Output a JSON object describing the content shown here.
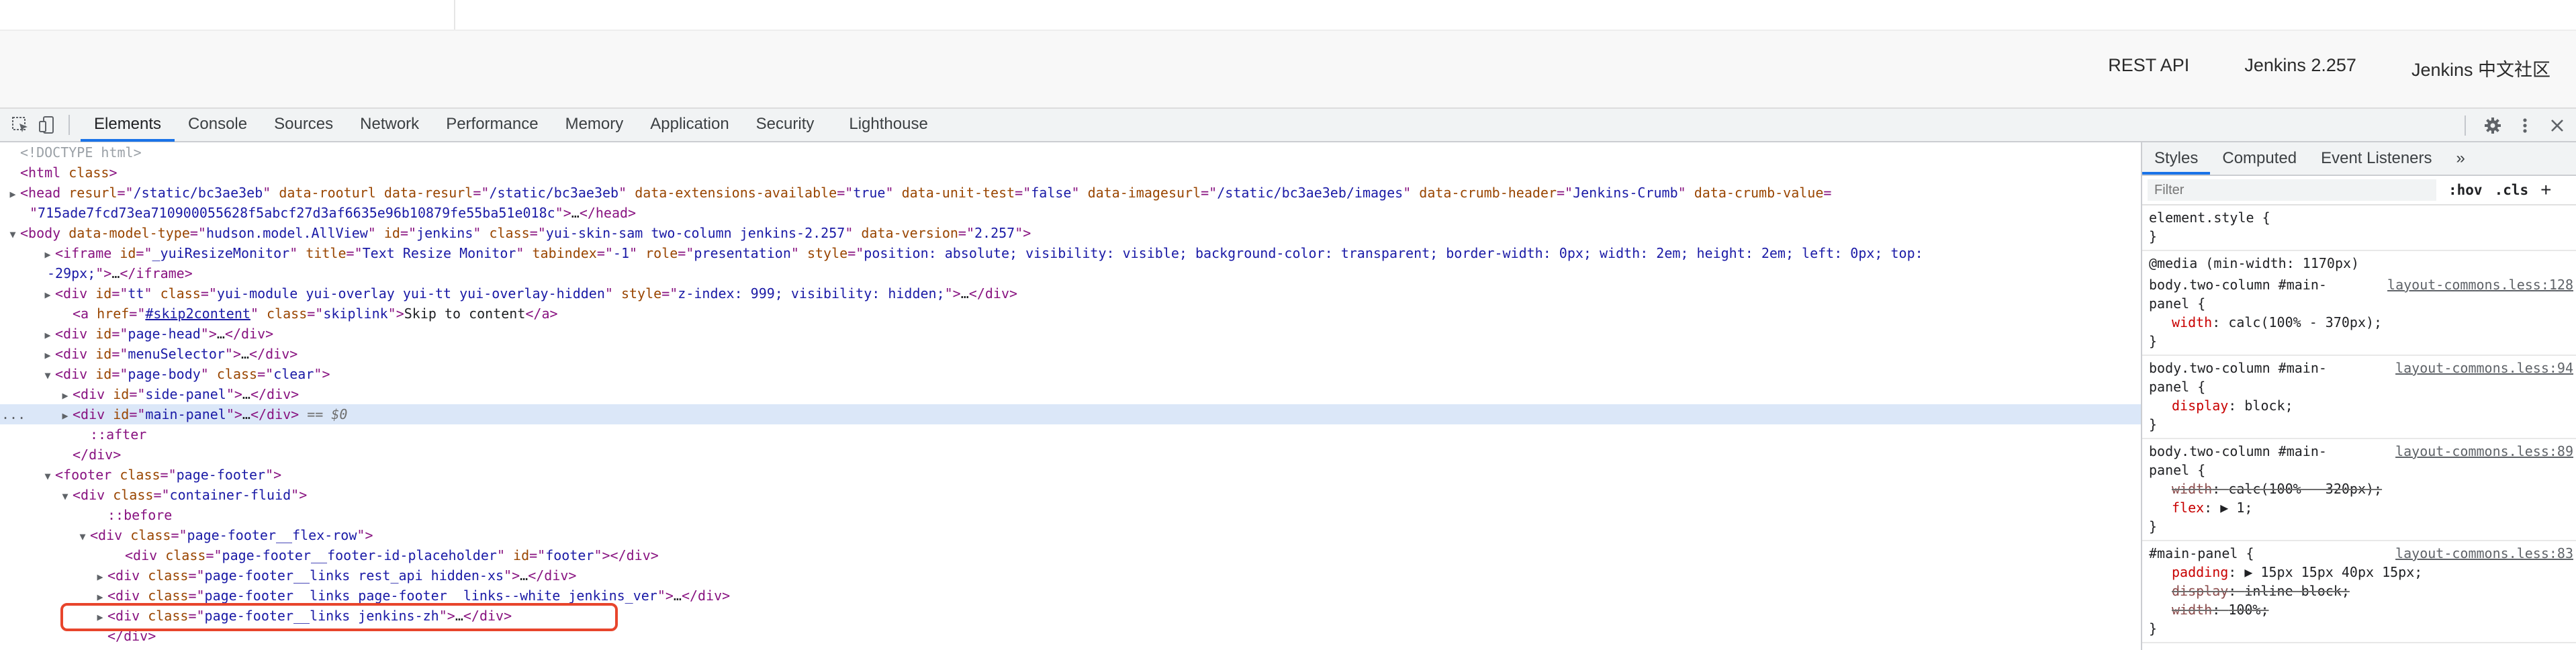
{
  "page": {
    "footer_links": [
      "REST API",
      "Jenkins 2.257",
      "Jenkins 中文社区"
    ]
  },
  "devtools": {
    "tabs": [
      "Elements",
      "Console",
      "Sources",
      "Network",
      "Performance",
      "Memory",
      "Application",
      "Security",
      "Lighthouse"
    ],
    "active_tab": "Elements",
    "icons": [
      "inspect-element-icon",
      "device-toolbar-icon",
      "settings-gear-icon",
      "more-vertical-icon",
      "close-icon"
    ]
  },
  "elements": {
    "lines": [
      {
        "seg": [
          {
            "c": "t-comment",
            "t": "<!DOCTYPE html>"
          }
        ]
      },
      {
        "seg": [
          {
            "c": "t-tag",
            "t": "<html "
          },
          {
            "c": "t-attr",
            "t": "class"
          },
          {
            "c": "t-tag",
            "t": ">"
          }
        ]
      },
      {
        "seg": [
          {
            "c": "t-tag",
            "t": "<head "
          },
          {
            "c": "t-attr",
            "t": "resurl"
          },
          {
            "c": "t-tag",
            "t": "=\""
          },
          {
            "c": "t-val",
            "t": "/static/bc3ae3eb"
          },
          {
            "c": "t-tag",
            "t": "\" "
          },
          {
            "c": "t-attr",
            "t": "data-rooturl"
          },
          {
            "c": "t-tag",
            "t": " "
          },
          {
            "c": "t-attr",
            "t": "data-resurl"
          },
          {
            "c": "t-tag",
            "t": "=\""
          },
          {
            "c": "t-val",
            "t": "/static/bc3ae3eb"
          },
          {
            "c": "t-tag",
            "t": "\" "
          },
          {
            "c": "t-attr",
            "t": "data-extensions-available"
          },
          {
            "c": "t-tag",
            "t": "=\""
          },
          {
            "c": "t-val",
            "t": "true"
          },
          {
            "c": "t-tag",
            "t": "\" "
          },
          {
            "c": "t-attr",
            "t": "data-unit-test"
          },
          {
            "c": "t-tag",
            "t": "=\""
          },
          {
            "c": "t-val",
            "t": "false"
          },
          {
            "c": "t-tag",
            "t": "\" "
          },
          {
            "c": "t-attr",
            "t": "data-imagesurl"
          },
          {
            "c": "t-tag",
            "t": "=\""
          },
          {
            "c": "t-val",
            "t": "/static/bc3ae3eb/images"
          },
          {
            "c": "t-tag",
            "t": "\" "
          },
          {
            "c": "t-attr",
            "t": "data-crumb-header"
          },
          {
            "c": "t-tag",
            "t": "=\""
          },
          {
            "c": "t-val",
            "t": "Jenkins-Crumb"
          },
          {
            "c": "t-tag",
            "t": "\" "
          },
          {
            "c": "t-attr",
            "t": "data-crumb-value"
          },
          {
            "c": "t-tag",
            "t": "="
          }
        ]
      },
      {
        "seg": [
          {
            "c": "t-tag",
            "t": "\""
          },
          {
            "c": "t-val",
            "t": "715ade7fcd73ea710900055628f5abcf27d3af6635e96b10879fe55ba51e018c"
          },
          {
            "c": "t-tag",
            "t": "\">"
          },
          {
            "c": "t-text",
            "t": "…"
          },
          {
            "c": "t-tag",
            "t": "</head>"
          }
        ]
      },
      {
        "seg": [
          {
            "c": "t-tag",
            "t": "<body "
          },
          {
            "c": "t-attr",
            "t": "data-model-type"
          },
          {
            "c": "t-tag",
            "t": "=\""
          },
          {
            "c": "t-val",
            "t": "hudson.model.AllView"
          },
          {
            "c": "t-tag",
            "t": "\" "
          },
          {
            "c": "t-attr",
            "t": "id"
          },
          {
            "c": "t-tag",
            "t": "=\""
          },
          {
            "c": "t-val",
            "t": "jenkins"
          },
          {
            "c": "t-tag",
            "t": "\" "
          },
          {
            "c": "t-attr",
            "t": "class"
          },
          {
            "c": "t-tag",
            "t": "=\""
          },
          {
            "c": "t-val",
            "t": "yui-skin-sam two-column jenkins-2.257"
          },
          {
            "c": "t-tag",
            "t": "\" "
          },
          {
            "c": "t-attr",
            "t": "data-version"
          },
          {
            "c": "t-tag",
            "t": "=\""
          },
          {
            "c": "t-val",
            "t": "2.257"
          },
          {
            "c": "t-tag",
            "t": "\">"
          }
        ]
      },
      {
        "seg": [
          {
            "c": "t-tag",
            "t": "<iframe "
          },
          {
            "c": "t-attr",
            "t": "id"
          },
          {
            "c": "t-tag",
            "t": "=\""
          },
          {
            "c": "t-val",
            "t": "_yuiResizeMonitor"
          },
          {
            "c": "t-tag",
            "t": "\" "
          },
          {
            "c": "t-attr",
            "t": "title"
          },
          {
            "c": "t-tag",
            "t": "=\""
          },
          {
            "c": "t-val",
            "t": "Text Resize Monitor"
          },
          {
            "c": "t-tag",
            "t": "\" "
          },
          {
            "c": "t-attr",
            "t": "tabindex"
          },
          {
            "c": "t-tag",
            "t": "=\""
          },
          {
            "c": "t-val",
            "t": "-1"
          },
          {
            "c": "t-tag",
            "t": "\" "
          },
          {
            "c": "t-attr",
            "t": "role"
          },
          {
            "c": "t-tag",
            "t": "=\""
          },
          {
            "c": "t-val",
            "t": "presentation"
          },
          {
            "c": "t-tag",
            "t": "\" "
          },
          {
            "c": "t-attr",
            "t": "style"
          },
          {
            "c": "t-tag",
            "t": "=\""
          },
          {
            "c": "t-val",
            "t": "position: absolute; visibility: visible; background-color: transparent; border-width: 0px; width: 2em; height: 2em; left: 0px; top:"
          }
        ]
      },
      {
        "seg": [
          {
            "c": "t-val",
            "t": "-29px;"
          },
          {
            "c": "t-tag",
            "t": "\">"
          },
          {
            "c": "t-text",
            "t": "…"
          },
          {
            "c": "t-tag",
            "t": "</iframe>"
          }
        ]
      },
      {
        "seg": [
          {
            "c": "t-tag",
            "t": "<div "
          },
          {
            "c": "t-attr",
            "t": "id"
          },
          {
            "c": "t-tag",
            "t": "=\""
          },
          {
            "c": "t-val",
            "t": "tt"
          },
          {
            "c": "t-tag",
            "t": "\" "
          },
          {
            "c": "t-attr",
            "t": "class"
          },
          {
            "c": "t-tag",
            "t": "=\""
          },
          {
            "c": "t-val",
            "t": "yui-module yui-overlay yui-tt yui-overlay-hidden"
          },
          {
            "c": "t-tag",
            "t": "\" "
          },
          {
            "c": "t-attr",
            "t": "style"
          },
          {
            "c": "t-tag",
            "t": "=\""
          },
          {
            "c": "t-val",
            "t": "z-index: 999; visibility: hidden;"
          },
          {
            "c": "t-tag",
            "t": "\">"
          },
          {
            "c": "t-text",
            "t": "…"
          },
          {
            "c": "t-tag",
            "t": "</div>"
          }
        ]
      },
      {
        "seg": [
          {
            "c": "t-tag",
            "t": "<a "
          },
          {
            "c": "t-attr",
            "t": "href"
          },
          {
            "c": "t-tag",
            "t": "=\""
          },
          {
            "c": "t-link",
            "t": "#skip2content"
          },
          {
            "c": "t-tag",
            "t": "\" "
          },
          {
            "c": "t-attr",
            "t": "class"
          },
          {
            "c": "t-tag",
            "t": "=\""
          },
          {
            "c": "t-val",
            "t": "skiplink"
          },
          {
            "c": "t-tag",
            "t": "\">"
          },
          {
            "c": "t-text",
            "t": "Skip to content"
          },
          {
            "c": "t-tag",
            "t": "</a>"
          }
        ]
      },
      {
        "seg": [
          {
            "c": "t-tag",
            "t": "<div "
          },
          {
            "c": "t-attr",
            "t": "id"
          },
          {
            "c": "t-tag",
            "t": "=\""
          },
          {
            "c": "t-val",
            "t": "page-head"
          },
          {
            "c": "t-tag",
            "t": "\">"
          },
          {
            "c": "t-text",
            "t": "…"
          },
          {
            "c": "t-tag",
            "t": "</div>"
          }
        ]
      },
      {
        "seg": [
          {
            "c": "t-tag",
            "t": "<div "
          },
          {
            "c": "t-attr",
            "t": "id"
          },
          {
            "c": "t-tag",
            "t": "=\""
          },
          {
            "c": "t-val",
            "t": "menuSelector"
          },
          {
            "c": "t-tag",
            "t": "\">"
          },
          {
            "c": "t-text",
            "t": "…"
          },
          {
            "c": "t-tag",
            "t": "</div>"
          }
        ]
      },
      {
        "seg": [
          {
            "c": "t-tag",
            "t": "<div "
          },
          {
            "c": "t-attr",
            "t": "id"
          },
          {
            "c": "t-tag",
            "t": "=\""
          },
          {
            "c": "t-val",
            "t": "page-body"
          },
          {
            "c": "t-tag",
            "t": "\" "
          },
          {
            "c": "t-attr",
            "t": "class"
          },
          {
            "c": "t-tag",
            "t": "=\""
          },
          {
            "c": "t-val",
            "t": "clear"
          },
          {
            "c": "t-tag",
            "t": "\">"
          }
        ]
      },
      {
        "seg": [
          {
            "c": "t-tag",
            "t": "<div "
          },
          {
            "c": "t-attr",
            "t": "id"
          },
          {
            "c": "t-tag",
            "t": "=\""
          },
          {
            "c": "t-val",
            "t": "side-panel"
          },
          {
            "c": "t-tag",
            "t": "\">"
          },
          {
            "c": "t-text",
            "t": "…"
          },
          {
            "c": "t-tag",
            "t": "</div>"
          }
        ]
      },
      {
        "seg": [
          {
            "c": "t-tag",
            "t": "<div "
          },
          {
            "c": "t-attr",
            "t": "id"
          },
          {
            "c": "t-tag",
            "t": "=\""
          },
          {
            "c": "t-val",
            "t": "main-panel"
          },
          {
            "c": "t-tag",
            "t": "\">"
          },
          {
            "c": "t-text",
            "t": "…"
          },
          {
            "c": "t-tag",
            "t": "</div>"
          },
          {
            "c": "t-eq",
            "t": " == $0"
          }
        ]
      },
      {
        "seg": [
          {
            "c": "t-pseudo",
            "t": "::after"
          }
        ]
      },
      {
        "seg": [
          {
            "c": "t-tag",
            "t": "</div>"
          }
        ]
      },
      {
        "seg": [
          {
            "c": "t-tag",
            "t": "<footer "
          },
          {
            "c": "t-attr",
            "t": "class"
          },
          {
            "c": "t-tag",
            "t": "=\""
          },
          {
            "c": "t-val",
            "t": "page-footer"
          },
          {
            "c": "t-tag",
            "t": "\">"
          }
        ]
      },
      {
        "seg": [
          {
            "c": "t-tag",
            "t": "<div "
          },
          {
            "c": "t-attr",
            "t": "class"
          },
          {
            "c": "t-tag",
            "t": "=\""
          },
          {
            "c": "t-val",
            "t": "container-fluid"
          },
          {
            "c": "t-tag",
            "t": "\">"
          }
        ]
      },
      {
        "seg": [
          {
            "c": "t-pseudo",
            "t": "::before"
          }
        ]
      },
      {
        "seg": [
          {
            "c": "t-tag",
            "t": "<div "
          },
          {
            "c": "t-attr",
            "t": "class"
          },
          {
            "c": "t-tag",
            "t": "=\""
          },
          {
            "c": "t-val",
            "t": "page-footer__flex-row"
          },
          {
            "c": "t-tag",
            "t": "\">"
          }
        ]
      },
      {
        "seg": [
          {
            "c": "t-tag",
            "t": "<div "
          },
          {
            "c": "t-attr",
            "t": "class"
          },
          {
            "c": "t-tag",
            "t": "=\""
          },
          {
            "c": "t-val",
            "t": "page-footer__footer-id-placeholder"
          },
          {
            "c": "t-tag",
            "t": "\" "
          },
          {
            "c": "t-attr",
            "t": "id"
          },
          {
            "c": "t-tag",
            "t": "=\""
          },
          {
            "c": "t-val",
            "t": "footer"
          },
          {
            "c": "t-tag",
            "t": "\"></div>"
          }
        ]
      },
      {
        "seg": [
          {
            "c": "t-tag",
            "t": "<div "
          },
          {
            "c": "t-attr",
            "t": "class"
          },
          {
            "c": "t-tag",
            "t": "=\""
          },
          {
            "c": "t-val",
            "t": "page-footer__links rest_api hidden-xs"
          },
          {
            "c": "t-tag",
            "t": "\">"
          },
          {
            "c": "t-text",
            "t": "…"
          },
          {
            "c": "t-tag",
            "t": "</div>"
          }
        ]
      },
      {
        "seg": [
          {
            "c": "t-tag",
            "t": "<div "
          },
          {
            "c": "t-attr",
            "t": "class"
          },
          {
            "c": "t-tag",
            "t": "=\""
          },
          {
            "c": "t-val",
            "t": "page-footer__links page-footer__links--white jenkins_ver"
          },
          {
            "c": "t-tag",
            "t": "\">"
          },
          {
            "c": "t-text",
            "t": "…"
          },
          {
            "c": "t-tag",
            "t": "</div>"
          }
        ]
      },
      {
        "seg": [
          {
            "c": "t-tag",
            "t": "<div "
          },
          {
            "c": "t-attr",
            "t": "class"
          },
          {
            "c": "t-tag",
            "t": "=\""
          },
          {
            "c": "t-val",
            "t": "page-footer__links jenkins-zh"
          },
          {
            "c": "t-tag",
            "t": "\">"
          },
          {
            "c": "t-text",
            "t": "…"
          },
          {
            "c": "t-tag",
            "t": "</div>"
          }
        ]
      },
      {
        "seg": [
          {
            "c": "t-tag",
            "t": "</div>"
          }
        ]
      }
    ],
    "dots_label": "..."
  },
  "styles": {
    "tabs": [
      "Styles",
      "Computed",
      "Event Listeners",
      "»"
    ],
    "active_tab": "Styles",
    "filter_placeholder": "Filter",
    "hov_label": ":hov",
    "cls_label": ".cls",
    "plus_label": "+",
    "element_style": "element.style {",
    "close_brace": "}",
    "media_query": "@media (min-width: 1170px)",
    "rules": [
      {
        "selector_1": "body.two-column #main-",
        "selector_2": "panel {",
        "source": "layout-commons.less:128",
        "decls": [
          {
            "prop": "width",
            "val": "calc(100% - 370px);",
            "struck": false
          }
        ]
      },
      {
        "selector_1": "body.two-column #main-",
        "selector_2": "panel {",
        "source": "layout-commons.less:94",
        "decls": [
          {
            "prop": "display",
            "val": "block;",
            "struck": false
          }
        ]
      },
      {
        "selector_1": "body.two-column #main-",
        "selector_2": "panel {",
        "source": "layout-commons.less:89",
        "decls": [
          {
            "prop": "width",
            "val": "calc(100% - 320px);",
            "struck": true
          },
          {
            "prop": "flex",
            "val": "▶ 1;",
            "struck": false
          }
        ]
      },
      {
        "selector_1": "#main-panel {",
        "selector_2": "",
        "source": "layout-commons.less:83",
        "decls": [
          {
            "prop": "padding",
            "val": "▶ 15px 15px 40px 15px;",
            "struck": false
          },
          {
            "prop": "display",
            "val": "inline-block;",
            "struck": true
          },
          {
            "prop": "width",
            "val": "100%;",
            "struck": true
          }
        ]
      }
    ]
  }
}
